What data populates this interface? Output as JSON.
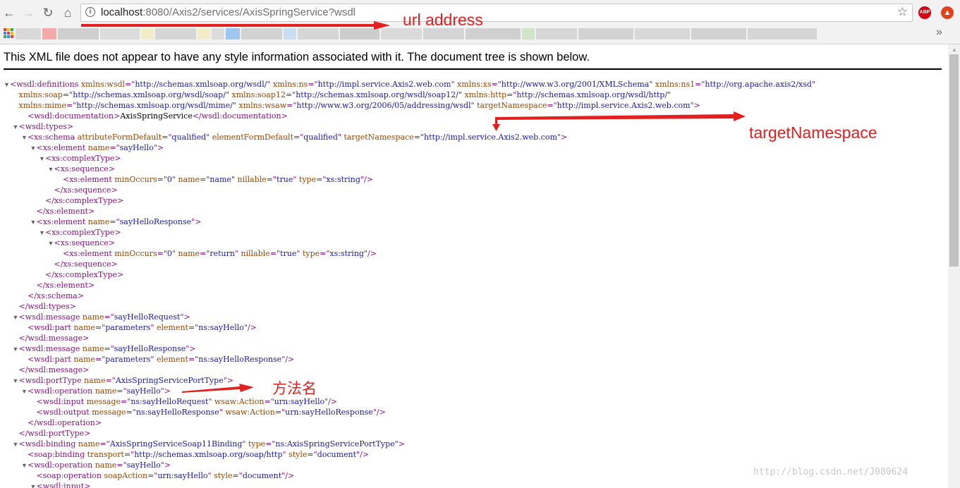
{
  "browser": {
    "url_host": "localhost",
    "url_rest": ":8080/Axis2/services/AxisSpringService?wsdl",
    "abp_label": "ABP"
  },
  "page": {
    "notice": "This XML file does not appear to have any style information associated with it. The document tree is shown below."
  },
  "annotations": {
    "url": "url address",
    "namespace": "targetNamespace",
    "method": "方法名"
  },
  "watermark": "http://blog.csdn.net/J080624",
  "xml_lines": [
    {
      "indent": 0,
      "toggle": true,
      "parts": [
        [
          "t",
          "<wsdl:definitions "
        ],
        [
          "a",
          "xmlns:wsdl"
        ],
        [
          "t",
          "=\""
        ],
        [
          "v",
          "http://schemas.xmlsoap.org/wsdl/"
        ],
        [
          "t",
          "\" "
        ],
        [
          "a",
          "xmlns:ns"
        ],
        [
          "t",
          "=\""
        ],
        [
          "v",
          "http://impl.service.Axis2.web.com"
        ],
        [
          "t",
          "\" "
        ],
        [
          "a",
          "xmlns:xs"
        ],
        [
          "t",
          "=\""
        ],
        [
          "v",
          "http://www.w3.org/2001/XMLSchema"
        ],
        [
          "t",
          "\" "
        ],
        [
          "a",
          "xmlns:ns1"
        ],
        [
          "t",
          "=\""
        ],
        [
          "v",
          "http://org.apache.axis2/xsd"
        ],
        [
          "t",
          "\""
        ]
      ]
    },
    {
      "indent": 1,
      "toggle": false,
      "parts": [
        [
          "a",
          "xmlns:soap"
        ],
        [
          "t",
          "=\""
        ],
        [
          "v",
          "http://schemas.xmlsoap.org/wsdl/soap/"
        ],
        [
          "t",
          "\" "
        ],
        [
          "a",
          "xmlns:soap12"
        ],
        [
          "t",
          "=\""
        ],
        [
          "v",
          "http://schemas.xmlsoap.org/wsdl/soap12/"
        ],
        [
          "t",
          "\" "
        ],
        [
          "a",
          "xmlns:http"
        ],
        [
          "t",
          "=\""
        ],
        [
          "v",
          "http://schemas.xmlsoap.org/wsdl/http/"
        ],
        [
          "t",
          "\""
        ]
      ]
    },
    {
      "indent": 1,
      "toggle": false,
      "parts": [
        [
          "a",
          "xmlns:mime"
        ],
        [
          "t",
          "=\""
        ],
        [
          "v",
          "http://schemas.xmlsoap.org/wsdl/mime/"
        ],
        [
          "t",
          "\" "
        ],
        [
          "a",
          "xmlns:wsaw"
        ],
        [
          "t",
          "=\""
        ],
        [
          "v",
          "http://www.w3.org/2006/05/addressing/wsdl"
        ],
        [
          "t",
          "\" "
        ],
        [
          "a",
          "targetNamespace"
        ],
        [
          "t",
          "=\""
        ],
        [
          "v",
          "http://impl.service.Axis2.web.com"
        ],
        [
          "t",
          "\">"
        ]
      ]
    },
    {
      "indent": 2,
      "toggle": false,
      "parts": [
        [
          "t",
          "<wsdl:documentation>"
        ],
        [
          "x",
          "AxisSpringService"
        ],
        [
          "t",
          "</wsdl:documentation>"
        ]
      ]
    },
    {
      "indent": 1,
      "toggle": true,
      "parts": [
        [
          "t",
          "<wsdl:types>"
        ]
      ]
    },
    {
      "indent": 2,
      "toggle": true,
      "parts": [
        [
          "t",
          "<xs:schema "
        ],
        [
          "a",
          "attributeFormDefault"
        ],
        [
          "t",
          "=\""
        ],
        [
          "v",
          "qualified"
        ],
        [
          "t",
          "\" "
        ],
        [
          "a",
          "elementFormDefault"
        ],
        [
          "t",
          "=\""
        ],
        [
          "v",
          "qualified"
        ],
        [
          "t",
          "\" "
        ],
        [
          "a",
          "targetNamespace"
        ],
        [
          "t",
          "=\""
        ],
        [
          "v",
          "http://impl.service.Axis2.web.com"
        ],
        [
          "t",
          "\">"
        ]
      ]
    },
    {
      "indent": 3,
      "toggle": true,
      "parts": [
        [
          "t",
          "<xs:element "
        ],
        [
          "a",
          "name"
        ],
        [
          "t",
          "=\""
        ],
        [
          "v",
          "sayHello"
        ],
        [
          "t",
          "\">"
        ]
      ]
    },
    {
      "indent": 4,
      "toggle": true,
      "parts": [
        [
          "t",
          "<xs:complexType>"
        ]
      ]
    },
    {
      "indent": 5,
      "toggle": true,
      "parts": [
        [
          "t",
          "<xs:sequence>"
        ]
      ]
    },
    {
      "indent": 6,
      "toggle": false,
      "parts": [
        [
          "t",
          "<xs:element "
        ],
        [
          "a",
          "minOccurs"
        ],
        [
          "t",
          "=\""
        ],
        [
          "v",
          "0"
        ],
        [
          "t",
          "\" "
        ],
        [
          "a",
          "name"
        ],
        [
          "t",
          "=\""
        ],
        [
          "v",
          "name"
        ],
        [
          "t",
          "\" "
        ],
        [
          "a",
          "nillable"
        ],
        [
          "t",
          "=\""
        ],
        [
          "v",
          "true"
        ],
        [
          "t",
          "\" "
        ],
        [
          "a",
          "type"
        ],
        [
          "t",
          "=\""
        ],
        [
          "v",
          "xs:string"
        ],
        [
          "t",
          "\"/>"
        ]
      ]
    },
    {
      "indent": 5,
      "toggle": false,
      "parts": [
        [
          "t",
          "</xs:sequence>"
        ]
      ]
    },
    {
      "indent": 4,
      "toggle": false,
      "parts": [
        [
          "t",
          "</xs:complexType>"
        ]
      ]
    },
    {
      "indent": 3,
      "toggle": false,
      "parts": [
        [
          "t",
          "</xs:element>"
        ]
      ]
    },
    {
      "indent": 3,
      "toggle": true,
      "parts": [
        [
          "t",
          "<xs:element "
        ],
        [
          "a",
          "name"
        ],
        [
          "t",
          "=\""
        ],
        [
          "v",
          "sayHelloResponse"
        ],
        [
          "t",
          "\">"
        ]
      ]
    },
    {
      "indent": 4,
      "toggle": true,
      "parts": [
        [
          "t",
          "<xs:complexType>"
        ]
      ]
    },
    {
      "indent": 5,
      "toggle": true,
      "parts": [
        [
          "t",
          "<xs:sequence>"
        ]
      ]
    },
    {
      "indent": 6,
      "toggle": false,
      "parts": [
        [
          "t",
          "<xs:element "
        ],
        [
          "a",
          "minOccurs"
        ],
        [
          "t",
          "=\""
        ],
        [
          "v",
          "0"
        ],
        [
          "t",
          "\" "
        ],
        [
          "a",
          "name"
        ],
        [
          "t",
          "=\""
        ],
        [
          "v",
          "return"
        ],
        [
          "t",
          "\" "
        ],
        [
          "a",
          "nillable"
        ],
        [
          "t",
          "=\""
        ],
        [
          "v",
          "true"
        ],
        [
          "t",
          "\" "
        ],
        [
          "a",
          "type"
        ],
        [
          "t",
          "=\""
        ],
        [
          "v",
          "xs:string"
        ],
        [
          "t",
          "\"/>"
        ]
      ]
    },
    {
      "indent": 5,
      "toggle": false,
      "parts": [
        [
          "t",
          "</xs:sequence>"
        ]
      ]
    },
    {
      "indent": 4,
      "toggle": false,
      "parts": [
        [
          "t",
          "</xs:complexType>"
        ]
      ]
    },
    {
      "indent": 3,
      "toggle": false,
      "parts": [
        [
          "t",
          "</xs:element>"
        ]
      ]
    },
    {
      "indent": 2,
      "toggle": false,
      "parts": [
        [
          "t",
          "</xs:schema>"
        ]
      ]
    },
    {
      "indent": 1,
      "toggle": false,
      "parts": [
        [
          "t",
          "</wsdl:types>"
        ]
      ]
    },
    {
      "indent": 1,
      "toggle": true,
      "parts": [
        [
          "t",
          "<wsdl:message "
        ],
        [
          "a",
          "name"
        ],
        [
          "t",
          "=\""
        ],
        [
          "v",
          "sayHelloRequest"
        ],
        [
          "t",
          "\">"
        ]
      ]
    },
    {
      "indent": 2,
      "toggle": false,
      "parts": [
        [
          "t",
          "<wsdl:part "
        ],
        [
          "a",
          "name"
        ],
        [
          "t",
          "=\""
        ],
        [
          "v",
          "parameters"
        ],
        [
          "t",
          "\" "
        ],
        [
          "a",
          "element"
        ],
        [
          "t",
          "=\""
        ],
        [
          "v",
          "ns:sayHello"
        ],
        [
          "t",
          "\"/>"
        ]
      ]
    },
    {
      "indent": 1,
      "toggle": false,
      "parts": [
        [
          "t",
          "</wsdl:message>"
        ]
      ]
    },
    {
      "indent": 1,
      "toggle": true,
      "parts": [
        [
          "t",
          "<wsdl:message "
        ],
        [
          "a",
          "name"
        ],
        [
          "t",
          "=\""
        ],
        [
          "v",
          "sayHelloResponse"
        ],
        [
          "t",
          "\">"
        ]
      ]
    },
    {
      "indent": 2,
      "toggle": false,
      "parts": [
        [
          "t",
          "<wsdl:part "
        ],
        [
          "a",
          "name"
        ],
        [
          "t",
          "=\""
        ],
        [
          "v",
          "parameters"
        ],
        [
          "t",
          "\" "
        ],
        [
          "a",
          "element"
        ],
        [
          "t",
          "=\""
        ],
        [
          "v",
          "ns:sayHelloResponse"
        ],
        [
          "t",
          "\"/>"
        ]
      ]
    },
    {
      "indent": 1,
      "toggle": false,
      "parts": [
        [
          "t",
          "</wsdl:message>"
        ]
      ]
    },
    {
      "indent": 1,
      "toggle": true,
      "parts": [
        [
          "t",
          "<wsdl:portType "
        ],
        [
          "a",
          "name"
        ],
        [
          "t",
          "=\""
        ],
        [
          "v",
          "AxisSpringServicePortType"
        ],
        [
          "t",
          "\">"
        ]
      ]
    },
    {
      "indent": 2,
      "toggle": true,
      "parts": [
        [
          "t",
          "<wsdl:operation "
        ],
        [
          "a",
          "name"
        ],
        [
          "t",
          "=\""
        ],
        [
          "v",
          "sayHello"
        ],
        [
          "t",
          "\">"
        ]
      ]
    },
    {
      "indent": 3,
      "toggle": false,
      "parts": [
        [
          "t",
          "<wsdl:input "
        ],
        [
          "a",
          "message"
        ],
        [
          "t",
          "=\""
        ],
        [
          "v",
          "ns:sayHelloRequest"
        ],
        [
          "t",
          "\" "
        ],
        [
          "a",
          "wsaw:Action"
        ],
        [
          "t",
          "=\""
        ],
        [
          "v",
          "urn:sayHello"
        ],
        [
          "t",
          "\"/>"
        ]
      ]
    },
    {
      "indent": 3,
      "toggle": false,
      "parts": [
        [
          "t",
          "<wsdl:output "
        ],
        [
          "a",
          "message"
        ],
        [
          "t",
          "=\""
        ],
        [
          "v",
          "ns:sayHelloResponse"
        ],
        [
          "t",
          "\" "
        ],
        [
          "a",
          "wsaw:Action"
        ],
        [
          "t",
          "=\""
        ],
        [
          "v",
          "urn:sayHelloResponse"
        ],
        [
          "t",
          "\"/>"
        ]
      ]
    },
    {
      "indent": 2,
      "toggle": false,
      "parts": [
        [
          "t",
          "</wsdl:operation>"
        ]
      ]
    },
    {
      "indent": 1,
      "toggle": false,
      "parts": [
        [
          "t",
          "</wsdl:portType>"
        ]
      ]
    },
    {
      "indent": 1,
      "toggle": true,
      "parts": [
        [
          "t",
          "<wsdl:binding "
        ],
        [
          "a",
          "name"
        ],
        [
          "t",
          "=\""
        ],
        [
          "v",
          "AxisSpringServiceSoap11Binding"
        ],
        [
          "t",
          "\" "
        ],
        [
          "a",
          "type"
        ],
        [
          "t",
          "=\""
        ],
        [
          "v",
          "ns:AxisSpringServicePortType"
        ],
        [
          "t",
          "\">"
        ]
      ]
    },
    {
      "indent": 2,
      "toggle": false,
      "parts": [
        [
          "t",
          "<soap:binding "
        ],
        [
          "a",
          "transport"
        ],
        [
          "t",
          "=\""
        ],
        [
          "v",
          "http://schemas.xmlsoap.org/soap/http"
        ],
        [
          "t",
          "\" "
        ],
        [
          "a",
          "style"
        ],
        [
          "t",
          "=\""
        ],
        [
          "v",
          "document"
        ],
        [
          "t",
          "\"/>"
        ]
      ]
    },
    {
      "indent": 2,
      "toggle": true,
      "parts": [
        [
          "t",
          "<wsdl:operation "
        ],
        [
          "a",
          "name"
        ],
        [
          "t",
          "=\""
        ],
        [
          "v",
          "sayHello"
        ],
        [
          "t",
          "\">"
        ]
      ]
    },
    {
      "indent": 3,
      "toggle": false,
      "parts": [
        [
          "t",
          "<soap:operation "
        ],
        [
          "a",
          "soapAction"
        ],
        [
          "t",
          "=\""
        ],
        [
          "v",
          "urn:sayHello"
        ],
        [
          "t",
          "\" "
        ],
        [
          "a",
          "style"
        ],
        [
          "t",
          "=\""
        ],
        [
          "v",
          "document"
        ],
        [
          "t",
          "\"/>"
        ]
      ]
    },
    {
      "indent": 3,
      "toggle": true,
      "parts": [
        [
          "t",
          "<wsdl:input>"
        ]
      ]
    }
  ]
}
